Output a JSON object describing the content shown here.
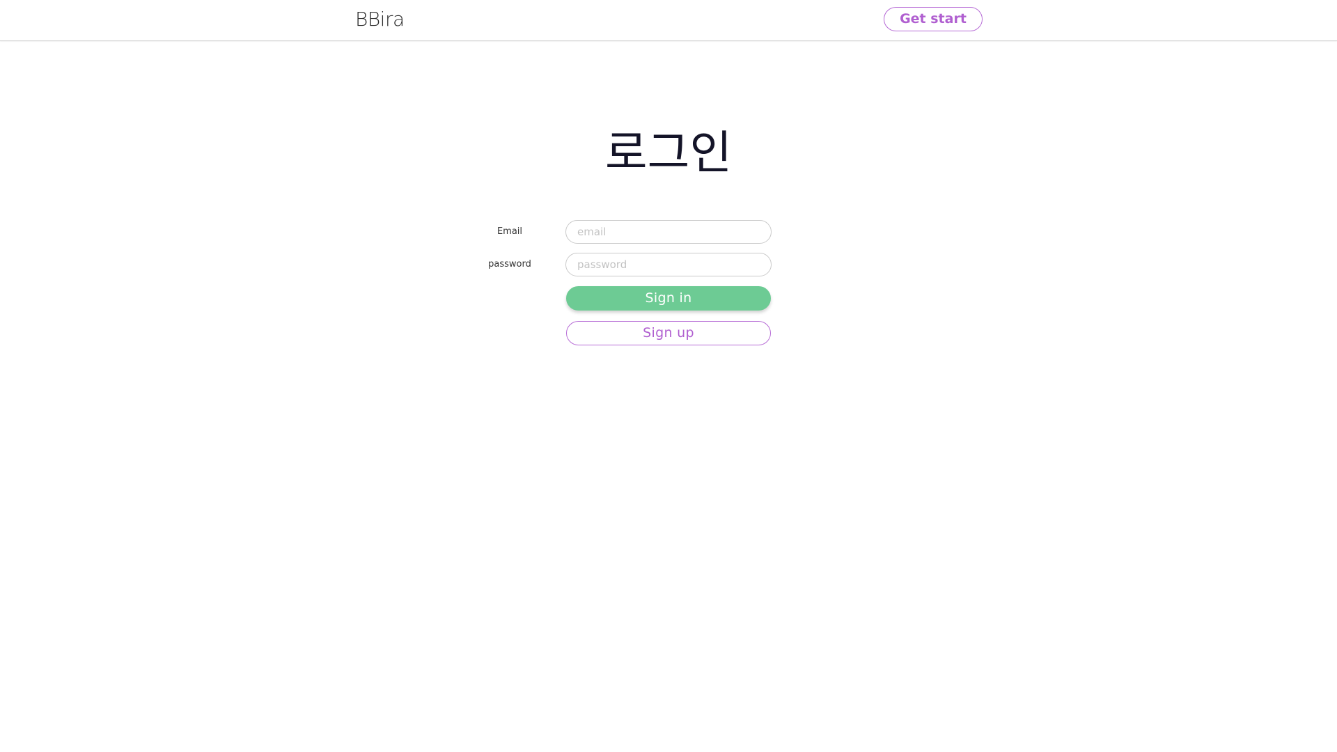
{
  "header": {
    "brand": "BBira",
    "get_start_label": "Get start"
  },
  "login": {
    "title": "로그인",
    "email_label": "Email",
    "email_placeholder": "email",
    "password_label": "password",
    "password_placeholder": "password",
    "sign_in_label": "Sign in",
    "sign_up_label": "Sign up"
  },
  "colors": {
    "accent_purple": "#b05fd0",
    "sign_in_green": "#6dcb94",
    "title_text": "#141428"
  }
}
